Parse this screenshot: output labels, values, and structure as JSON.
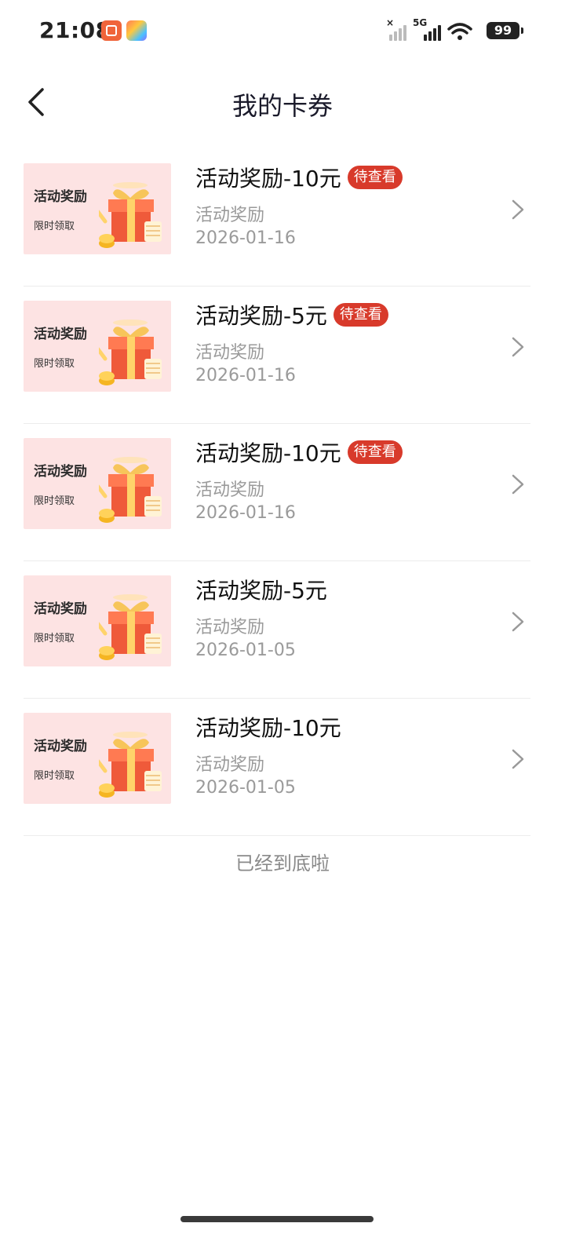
{
  "status_bar": {
    "time": "21:08",
    "network": "5G",
    "battery": "99"
  },
  "header": {
    "title": "我的卡券"
  },
  "coupons": [
    {
      "thumb_title": "活动奖励",
      "thumb_sub": "限时领取",
      "title": "活动奖励-10元",
      "badge": "待查看",
      "type": "活动奖励",
      "date": "2026-01-16"
    },
    {
      "thumb_title": "活动奖励",
      "thumb_sub": "限时领取",
      "title": "活动奖励-5元",
      "badge": "待查看",
      "type": "活动奖励",
      "date": "2026-01-16"
    },
    {
      "thumb_title": "活动奖励",
      "thumb_sub": "限时领取",
      "title": "活动奖励-10元",
      "badge": "待查看",
      "type": "活动奖励",
      "date": "2026-01-16"
    },
    {
      "thumb_title": "活动奖励",
      "thumb_sub": "限时领取",
      "title": "活动奖励-5元",
      "type": "活动奖励",
      "date": "2026-01-05"
    },
    {
      "thumb_title": "活动奖励",
      "thumb_sub": "限时领取",
      "title": "活动奖励-10元",
      "type": "活动奖励",
      "date": "2026-01-05"
    }
  ],
  "footer": {
    "end_text": "已经到底啦"
  },
  "colors": {
    "badge": "#d83a2b",
    "thumb_bg": "#fde3e3",
    "secondary_text": "#9a9a9a"
  }
}
